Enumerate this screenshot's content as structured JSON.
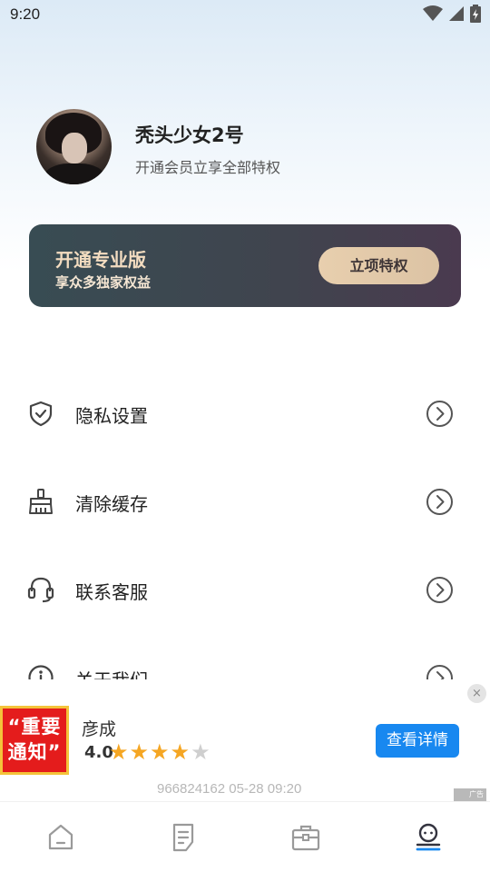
{
  "status_bar": {
    "time": "9:20",
    "icons": [
      "wifi-icon",
      "signal-icon",
      "battery-icon"
    ]
  },
  "profile": {
    "name": "秃头少女2号",
    "subtitle": "开通会员立享全部特权"
  },
  "vip_card": {
    "title": "开通专业版",
    "subtitle": "享众多独家权益",
    "button_label": "立项特权"
  },
  "menu": {
    "items": [
      {
        "label": "隐私设置",
        "icon": "shield-check-icon"
      },
      {
        "label": "清除缓存",
        "icon": "broom-icon"
      },
      {
        "label": "联系客服",
        "icon": "headset-icon"
      },
      {
        "label": "关于我们",
        "icon": "info-icon"
      }
    ]
  },
  "ad": {
    "image_text": "“重要通知”",
    "title": "彦成",
    "rating": "4.0",
    "stars_filled": 4,
    "stars_total": 5,
    "button_label": "查看详情",
    "meta": "966824162   05-28 09:20",
    "badge": "广告",
    "close": "×"
  },
  "tab_bar": {
    "tabs": [
      {
        "icon": "home-icon",
        "active": false
      },
      {
        "icon": "document-icon",
        "active": false
      },
      {
        "icon": "briefcase-icon",
        "active": false
      },
      {
        "icon": "user-icon",
        "active": true
      }
    ]
  },
  "colors": {
    "accent_blue": "#1888f0",
    "vip_gold": "#e8cfae",
    "star": "#f5a623",
    "icon": "#555555"
  }
}
